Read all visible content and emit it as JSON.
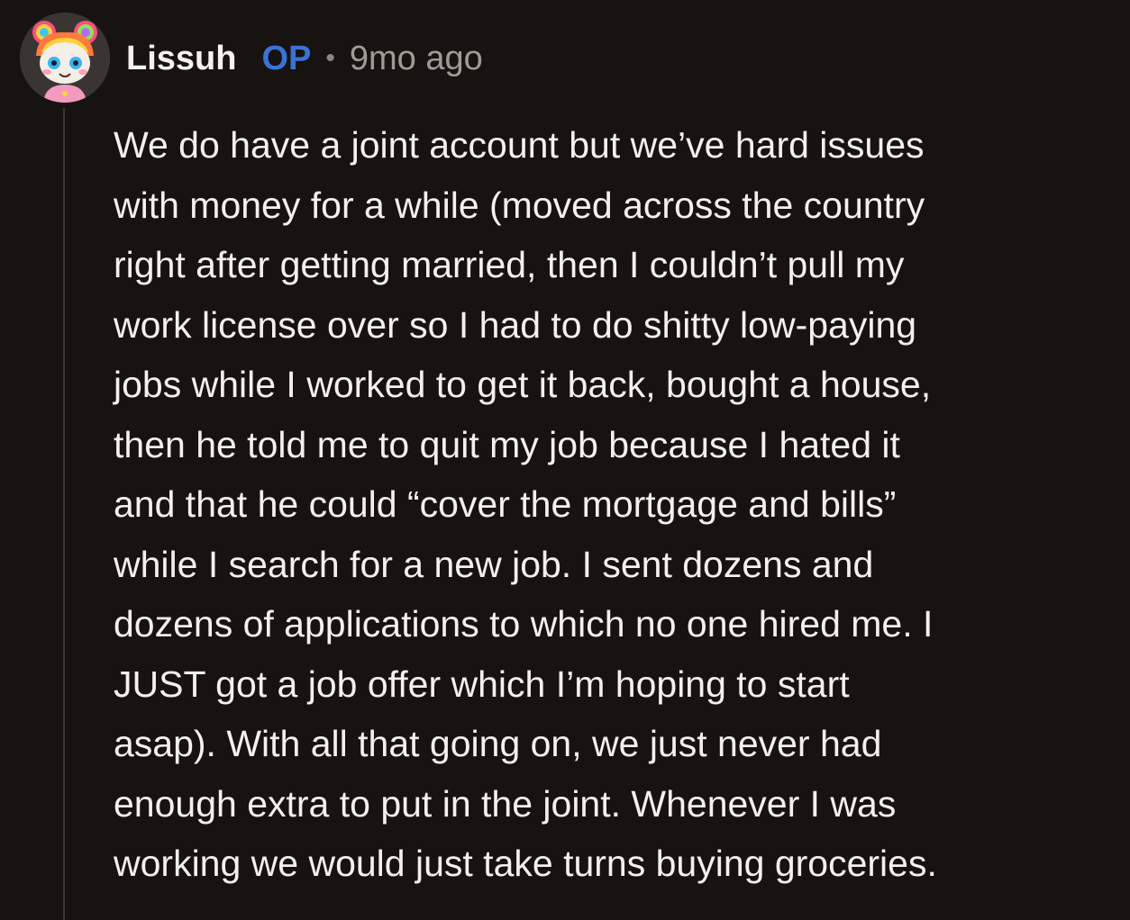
{
  "comment": {
    "author": "Lissuh",
    "op_badge": "OP",
    "separator": "•",
    "timestamp": "9mo ago",
    "avatar_icon": "cartoon-avatar-rainbow-hair-buns",
    "body_lines": [
      "We do have a joint account but we’ve hard issues",
      "with money for a while (moved across the country",
      "right after getting married, then I couldn’t pull my",
      "work license over so I had to do shitty low-paying",
      "jobs while I worked to get it back, bought a house,",
      "then he told me to quit my job because I hated it",
      "and that he could “cover the mortgage and bills”",
      "while I search for a new job. I sent dozens and",
      "dozens of applications to which no one hired me. I",
      "JUST got a job offer which I’m hoping to start",
      "asap). With all that going on, we just never had",
      "enough extra to put in the joint. Whenever I was",
      "working we would just take turns buying groceries."
    ]
  },
  "colors": {
    "background": "#161311",
    "text": "#f3f1ef",
    "op_blue": "#3a73d6",
    "muted": "#a19b96",
    "thread_line": "#3c3733"
  }
}
